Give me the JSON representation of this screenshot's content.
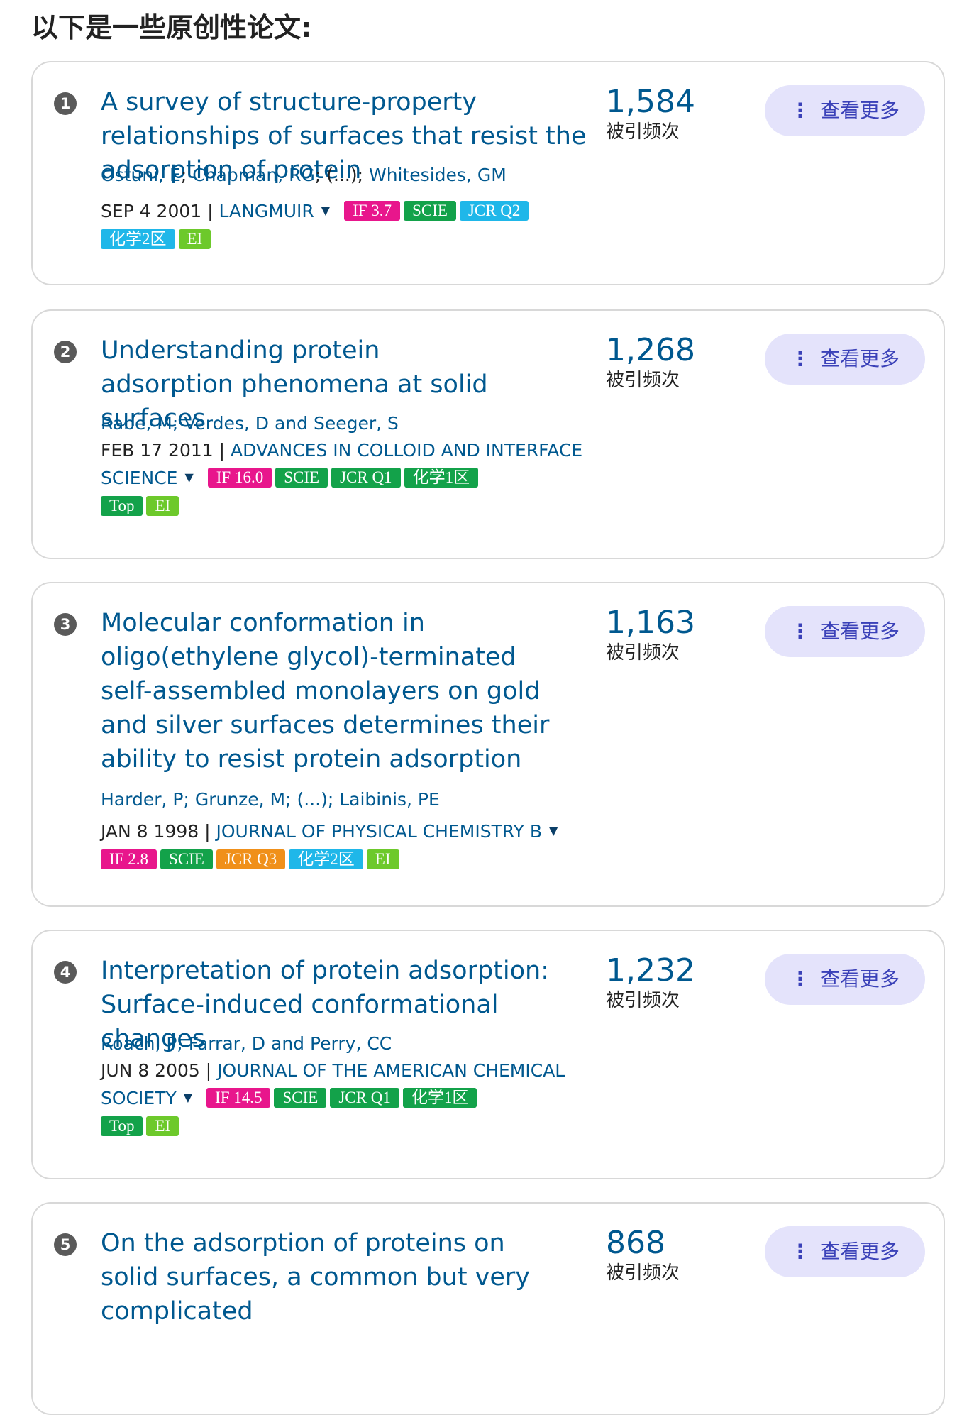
{
  "heading": "以下是一些原创性论文:",
  "more_label": "查看更多",
  "more_icon": "vertical-ellipsis-icon",
  "cites_label": "被引频次",
  "papers": [
    {
      "num": "1",
      "title": "A survey of structure-property relationships of surfaces that resist the adsorption of protein",
      "authors": [
        "Ostuni, E",
        "Chapman, RG",
        "(...)",
        "Whitesides, GM"
      ],
      "authors_text": "Ostuni, E; Chapman, RG; (...); Whitesides, GM",
      "date": "SEP 4 2001",
      "journal": "LANGMUIR",
      "badges": [
        "IF 3.7",
        "SCIE",
        "JCR Q2",
        "化学2区",
        "EI"
      ],
      "citations": "1,584"
    },
    {
      "num": "2",
      "title": "Understanding protein adsorption phenomena at solid surfaces",
      "authors_text": "Rabe, M; Verdes, D and Seeger, S",
      "date": "FEB 17 2011",
      "journal": "ADVANCES IN COLLOID AND INTERFACE SCIENCE",
      "badges": [
        "IF 16.0",
        "SCIE",
        "JCR Q1",
        "化学1区",
        "Top",
        "EI"
      ],
      "citations": "1,268"
    },
    {
      "num": "3",
      "title": "Molecular conformation in oligo(ethylene glycol)-terminated self-assembled monolayers on gold and silver surfaces determines their ability to resist protein adsorption",
      "authors_text": "Harder, P; Grunze, M; (...); Laibinis, PE",
      "date": "JAN 8 1998",
      "journal": "JOURNAL OF PHYSICAL CHEMISTRY B",
      "badges": [
        "IF 2.8",
        "SCIE",
        "JCR Q3",
        "化学2区",
        "EI"
      ],
      "citations": "1,163"
    },
    {
      "num": "4",
      "title": "Interpretation of protein adsorption: Surface-induced conformational changes",
      "authors_text": "Roach, P; Farrar, D and Perry, CC",
      "date": "JUN 8 2005",
      "journal": "JOURNAL OF THE AMERICAN CHEMICAL SOCIETY",
      "badges": [
        "IF 14.5",
        "SCIE",
        "JCR Q1",
        "化学1区",
        "Top",
        "EI"
      ],
      "citations": "1,232"
    },
    {
      "num": "5",
      "title": "On the adsorption of proteins on solid surfaces, a common but very complicated",
      "citations": "868"
    }
  ],
  "colors": {
    "link": "#00588f",
    "if_badge": "#e8168c",
    "green_badge": "#13a24a",
    "cyan_badge": "#1fb7e9",
    "orange_badge": "#f0901a",
    "ei_badge": "#6dc92b",
    "more_button_bg": "#e4e3fb",
    "more_button_text": "#3a41b8"
  }
}
